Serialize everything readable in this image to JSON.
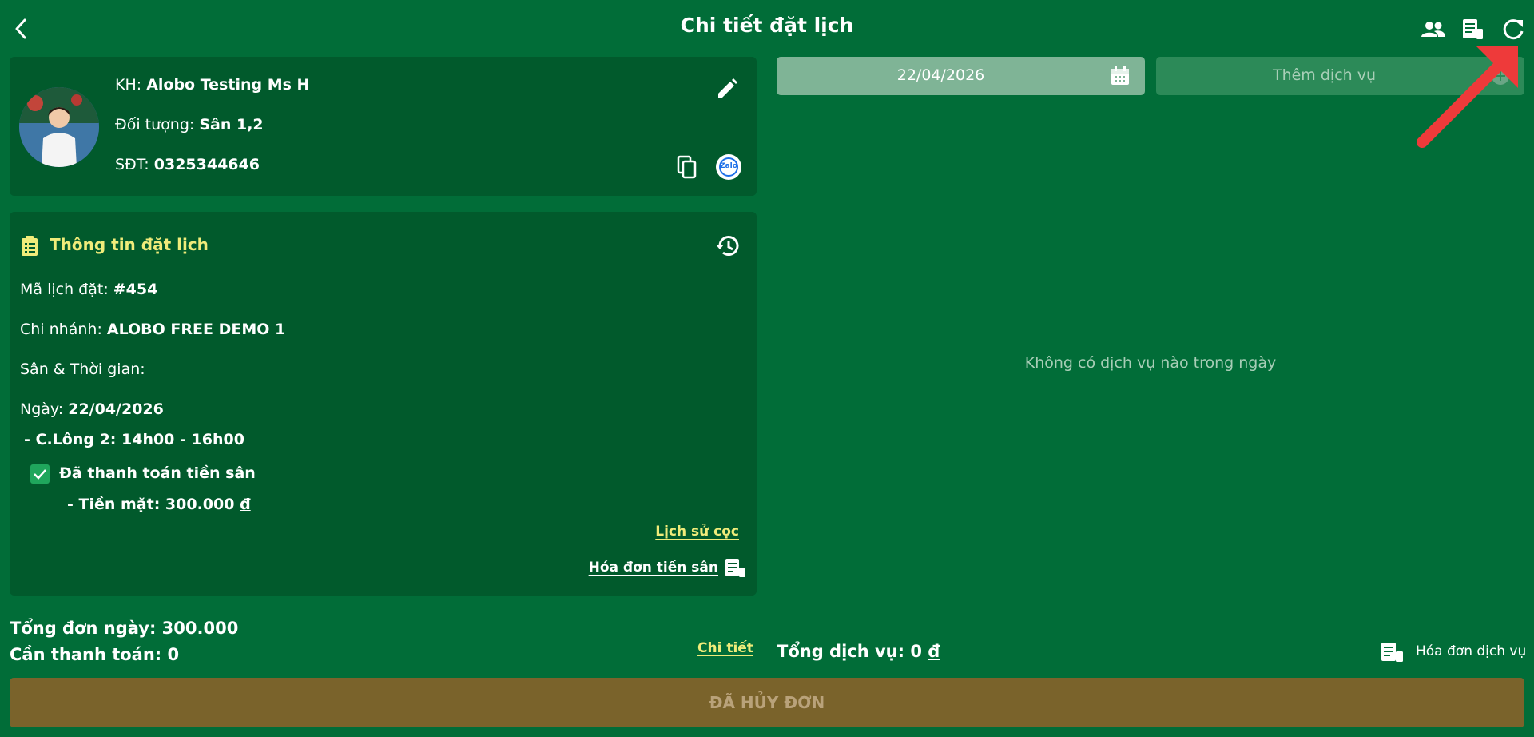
{
  "header": {
    "title": "Chi tiết đặt lịch",
    "icons": [
      "back-icon",
      "people-icon",
      "invoice-icon",
      "refresh-icon"
    ]
  },
  "customer": {
    "name_prefix": "KH: ",
    "name": "Alobo Testing Ms H",
    "target_prefix": "Đối tượng: ",
    "target": "Sân 1,2",
    "phone_prefix": "SĐT: ",
    "phone": "0325344646",
    "zalo_label": "Zalo"
  },
  "booking": {
    "section_title": "Thông tin đặt lịch",
    "code_prefix": "Mã lịch đặt: ",
    "code": "#454",
    "branch_prefix": "Chi nhánh: ",
    "branch": "ALOBO FREE DEMO 1",
    "court_time_label": "Sân & Thời gian:",
    "date_prefix": "Ngày: ",
    "date": "22/04/2026",
    "slot": "- C.Lông 2: 14h00 - 16h00",
    "paid_label": "Đã thanh toán tiền sân",
    "paid_checked": true,
    "cash_label": "- Tiền mặt: 300.000 ",
    "currency": "đ",
    "deposit_history_link": "Lịch sử cọc",
    "court_invoice_link": "Hóa đơn tiền sân"
  },
  "totals": {
    "day_total": "Tổng đơn ngày: 300.000",
    "to_pay": "Cần thanh toán: 0",
    "detail_link": "Chi tiết"
  },
  "services": {
    "date_value": "22/04/2026",
    "add_placeholder": "Thêm dịch vụ",
    "empty_message": "Không có dịch vụ nào trong ngày",
    "total_label": "Tổng dịch vụ: 0 ",
    "currency": "đ",
    "invoice_link": "Hóa đơn dịch vụ"
  },
  "cancel_button": "ĐÃ HỦY ĐƠN",
  "colors": {
    "background": "#016d38",
    "card": "#015a2c",
    "accent_yellow": "#f0ec7a",
    "cancel": "#7a632b",
    "annotation_arrow": "#ee3a3a"
  }
}
